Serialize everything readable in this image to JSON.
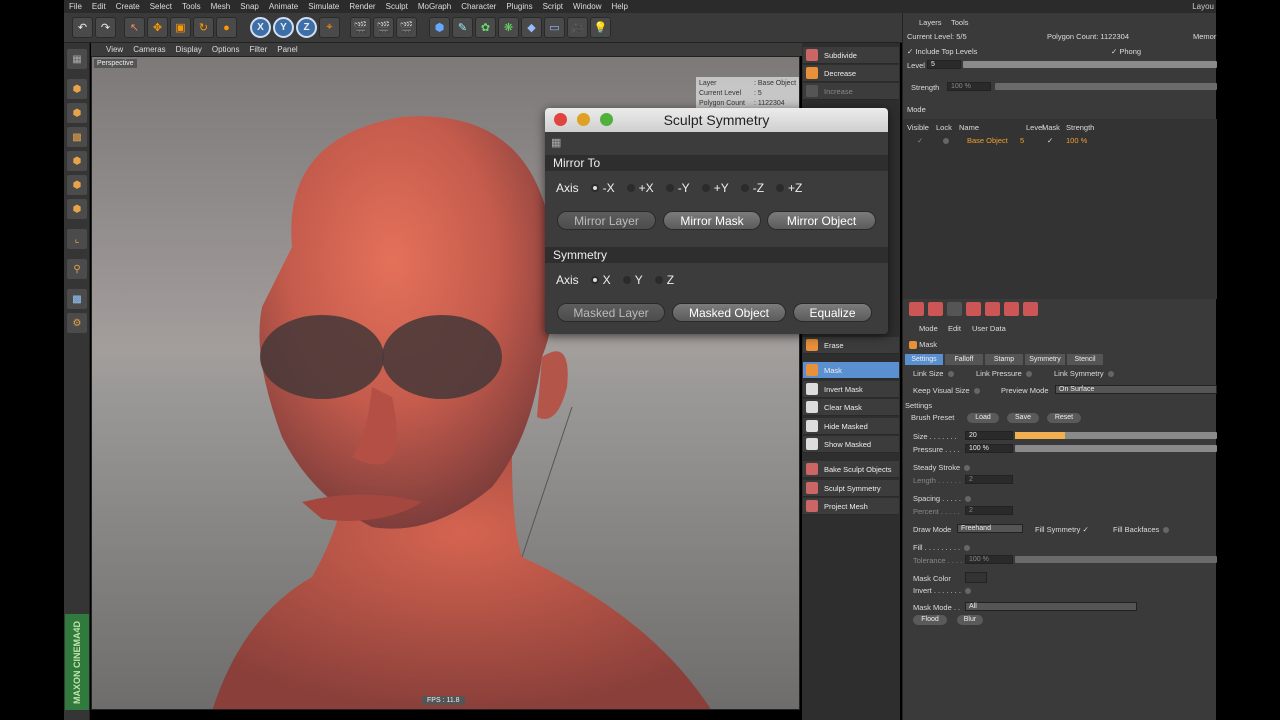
{
  "menubar": {
    "items": [
      "File",
      "Edit",
      "Create",
      "Select",
      "Tools",
      "Mesh",
      "Snap",
      "Animate",
      "Simulate",
      "Render",
      "Sculpt",
      "MoGraph",
      "Character",
      "Plugins",
      "Script",
      "Window",
      "Help"
    ],
    "layout_label": "Layou"
  },
  "viewport": {
    "menu": [
      "View",
      "Cameras",
      "Display",
      "Options",
      "Filter",
      "Panel"
    ],
    "camera_label": "Perspective",
    "fps": "FPS : 11.8",
    "hud": {
      "layer_key": "Layer",
      "layer_val": ": Base Object",
      "level_key": "Current Level",
      "level_val": ": 5",
      "poly_key": "Polygon Count",
      "poly_val": ": 1122304"
    }
  },
  "sculpt_panel": {
    "subdivide": "Subdivide",
    "decrease": "Decrease",
    "increase": "Increase",
    "erase": "Erase",
    "mask": "Mask",
    "invert_mask": "Invert Mask",
    "clear_mask": "Clear Mask",
    "hide_masked": "Hide Masked",
    "show_masked": "Show Masked",
    "bake": "Bake Sculpt Objects",
    "symmetry": "Sculpt Symmetry",
    "project": "Project Mesh"
  },
  "dialog": {
    "title": "Sculpt Symmetry",
    "mirror_to": "Mirror To",
    "axis_label": "Axis",
    "mirror_axes": [
      "-X",
      "+X",
      "-Y",
      "+Y",
      "-Z",
      "+Z"
    ],
    "mirror_layer": "Mirror Layer",
    "mirror_mask": "Mirror Mask",
    "mirror_object": "Mirror Object",
    "symmetry": "Symmetry",
    "sym_axes": [
      "X",
      "Y",
      "Z"
    ],
    "masked_layer": "Masked Layer",
    "masked_object": "Masked Object",
    "equalize": "Equalize"
  },
  "layers": {
    "tabs": [
      "Layers",
      "Tools"
    ],
    "current_level": "Current Level: 5/5",
    "polygon_count": "Polygon Count: 1122304",
    "memory": "Memor",
    "include_top": "Include Top Levels",
    "phong": "Phong",
    "level_label": "Level",
    "level_val": "5",
    "strength_label": "Strength",
    "strength_val": "100 %",
    "mode": "Mode",
    "cols": [
      "Visible",
      "Lock",
      "Name",
      "Level",
      "Mask",
      "Strength"
    ],
    "row": {
      "name": "Base Object",
      "level": "5",
      "strength": "100 %"
    }
  },
  "attributes": {
    "menu": [
      "Mode",
      "Edit",
      "User Data"
    ],
    "object": "Mask",
    "tabs": [
      "Settings",
      "Falloff",
      "Stamp",
      "Symmetry",
      "Stencil"
    ],
    "link_size": "Link Size",
    "link_pressure": "Link Pressure",
    "link_symmetry": "Link Symmetry",
    "keep_visual": "Keep Visual Size",
    "preview_mode": "Preview Mode",
    "preview_val": "On Surface",
    "settings": "Settings",
    "brush_preset": "Brush Preset",
    "load": "Load",
    "save": "Save",
    "reset": "Reset",
    "size_label": "Size . . . . . . .",
    "size_val": "20",
    "pressure_label": "Pressure . . . .",
    "pressure_val": "100 %",
    "steady": "Steady Stroke",
    "length_label": "Length . . . . . .",
    "length_val": "2",
    "spacing": "Spacing . . . . .",
    "percent_label": "Percent . . . . .",
    "percent_val": "2",
    "draw_mode": "Draw Mode",
    "draw_val": "Freehand",
    "fill_symmetry": "Fill Symmetry",
    "fill_backfaces": "Fill Backfaces",
    "fill": "Fill . . . . . . . . .",
    "tolerance_label": "Tolerance . . . .",
    "tolerance_val": "100 %",
    "mask_color": "Mask Color",
    "invert": "Invert . . . . . . .",
    "mask_mode": "Mask Mode . .",
    "mask_mode_val": "All",
    "flood": "Flood",
    "blur": "Blur"
  }
}
